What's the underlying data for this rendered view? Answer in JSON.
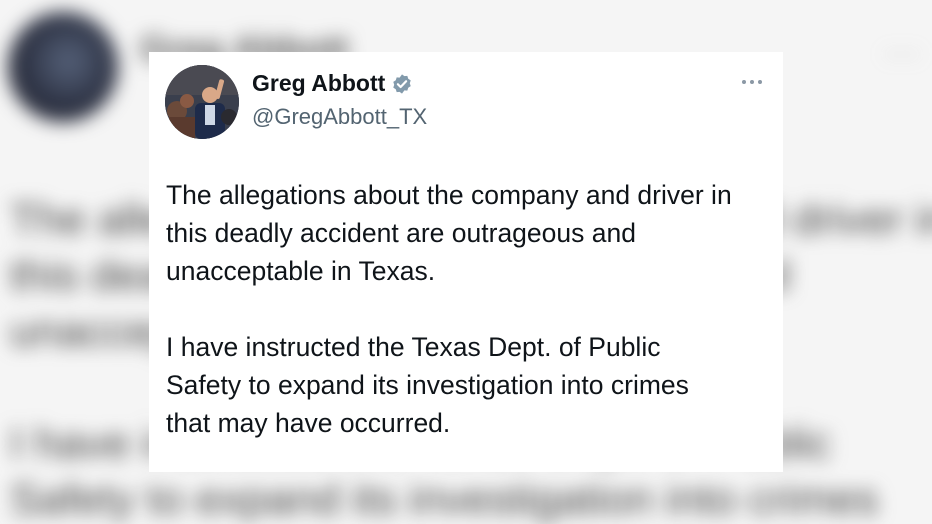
{
  "tweet": {
    "display_name": "Greg Abbott",
    "handle": "@GregAbbott_TX",
    "verified": true,
    "paragraphs": [
      [
        "The allegations about the company and driver in",
        "this deadly accident are outrageous and",
        "unacceptable in Texas."
      ],
      [
        "I have instructed the Texas Dept. of Public",
        "Safety to expand its investigation into crimes",
        "that may have occurred."
      ]
    ]
  },
  "background_echo": {
    "name": "Greg Abbott",
    "lines": [
      "The allegations about the company and driver in",
      "this deadly accident are outrageous and",
      "unacceptable in Texas.",
      "",
      "I have instructed the Texas Dept. of Public",
      "Safety to expand its investigation into crimes"
    ]
  },
  "colors": {
    "text_primary": "#0f1419",
    "text_secondary": "#536471",
    "verified_badge": "#829aab",
    "card_bg": "#ffffff"
  },
  "icons": {
    "verified": "verified-badge-icon",
    "more": "more-horizontal-icon"
  }
}
